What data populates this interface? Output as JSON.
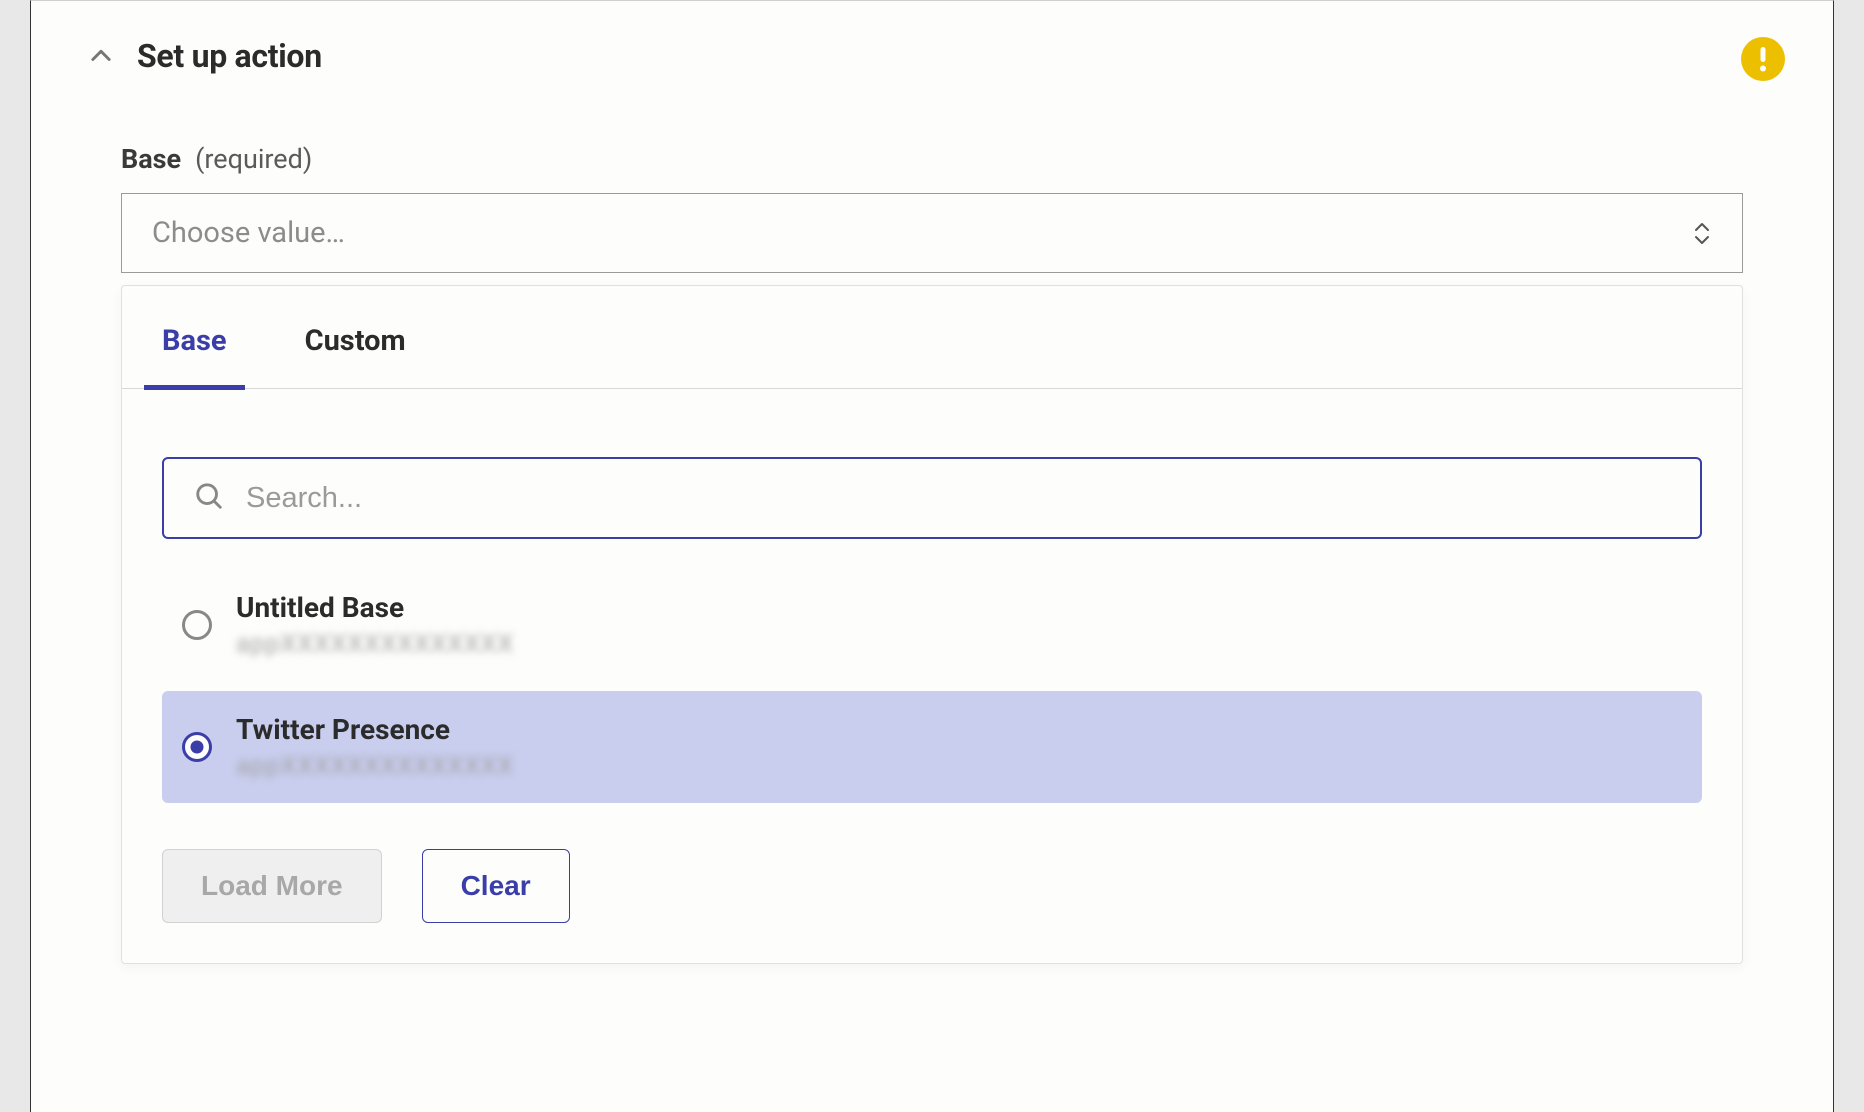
{
  "section": {
    "title": "Set up action"
  },
  "field": {
    "label": "Base",
    "required": "(required)",
    "placeholder": "Choose value…"
  },
  "dropdown": {
    "tabs": [
      {
        "label": "Base",
        "active": true
      },
      {
        "label": "Custom",
        "active": false
      }
    ],
    "search_placeholder": "Search...",
    "options": [
      {
        "label": "Untitled Base",
        "sub": "appXXXXXXXXXXXXXX",
        "selected": false
      },
      {
        "label": "Twitter Presence",
        "sub": "appXXXXXXXXXXXXXX",
        "selected": true
      }
    ],
    "buttons": {
      "load_more": "Load More",
      "clear": "Clear"
    }
  }
}
